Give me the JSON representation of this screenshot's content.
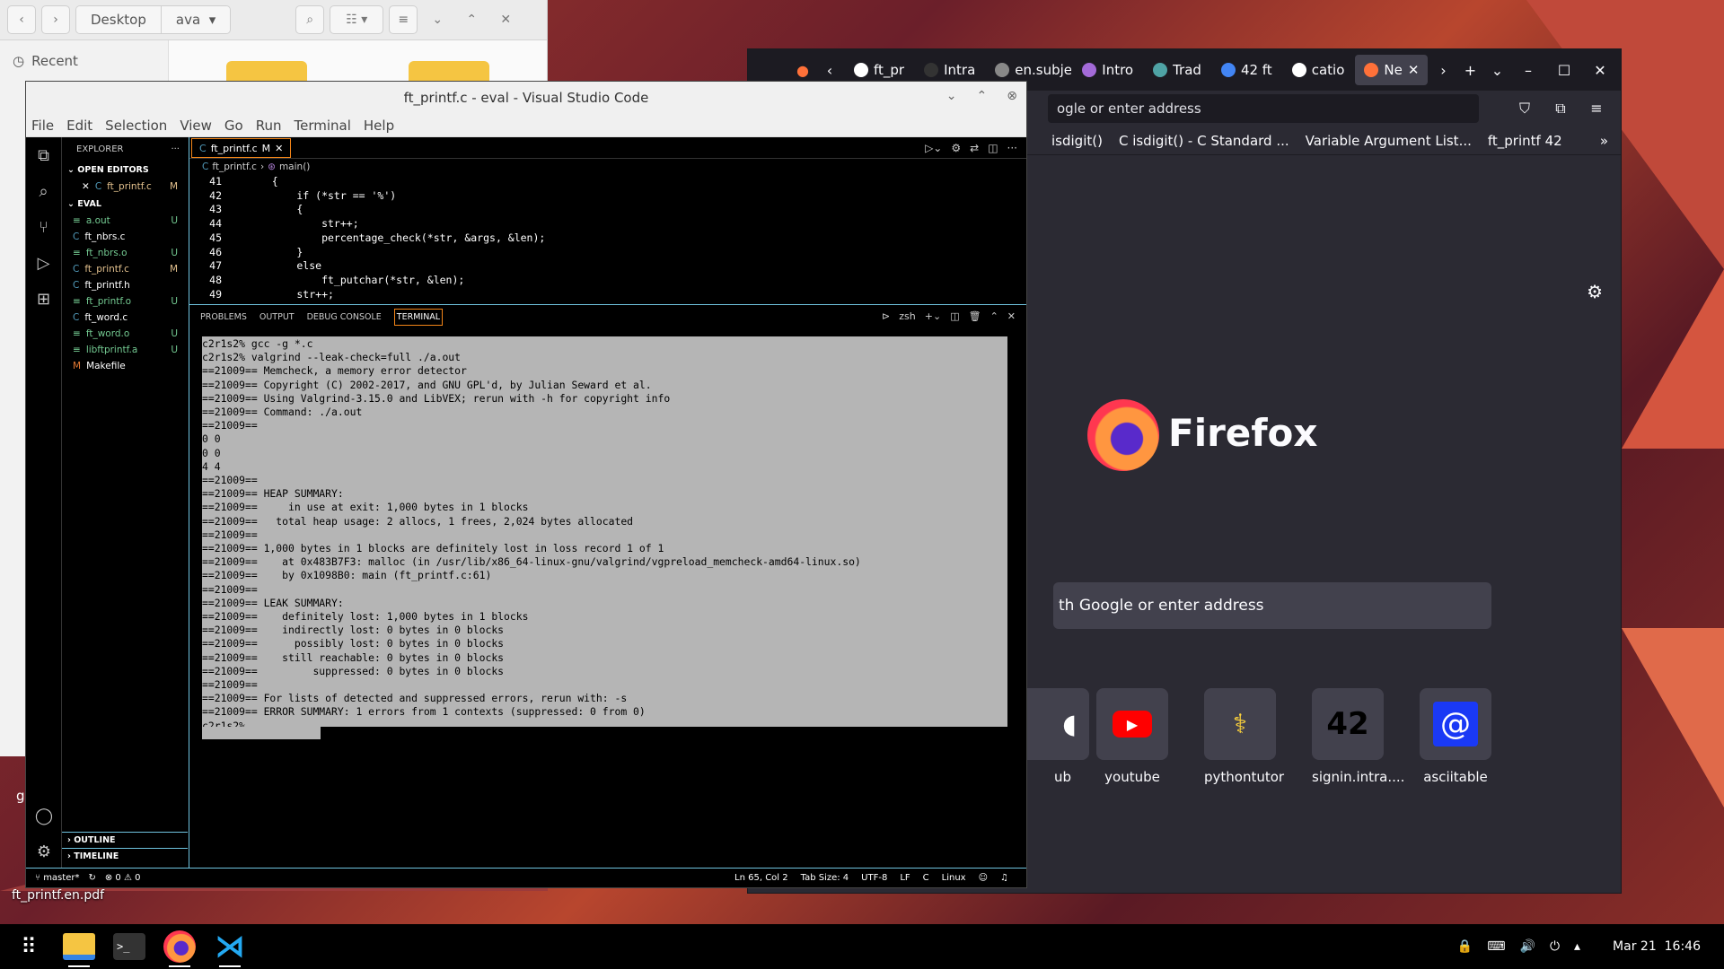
{
  "desktop": {
    "file_label": "ft_printf.en.pdf",
    "partial_label": "g"
  },
  "nautilus": {
    "path": [
      "Desktop",
      "ava"
    ],
    "sidebar_recent": "Recent"
  },
  "vscode": {
    "title": "ft_printf.c - eval - Visual Studio Code",
    "menu": [
      "File",
      "Edit",
      "Selection",
      "View",
      "Go",
      "Run",
      "Terminal",
      "Help"
    ],
    "explorer": {
      "header": "EXPLORER",
      "open_editors": "OPEN EDITORS",
      "open_file": "ft_printf.c",
      "open_file_badge": "M",
      "folder": "EVAL",
      "files": [
        {
          "name": "a.out",
          "badge": "U",
          "color": "#73c991",
          "icon": "≡"
        },
        {
          "name": "ft_nbrs.c",
          "badge": "",
          "color": "#ffffff",
          "icon": "C"
        },
        {
          "name": "ft_nbrs.o",
          "badge": "U",
          "color": "#73c991",
          "icon": "≡"
        },
        {
          "name": "ft_printf.c",
          "badge": "M",
          "color": "#e2c08d",
          "icon": "C"
        },
        {
          "name": "ft_printf.h",
          "badge": "",
          "color": "#ffffff",
          "icon": "C"
        },
        {
          "name": "ft_printf.o",
          "badge": "U",
          "color": "#73c991",
          "icon": "≡"
        },
        {
          "name": "ft_word.c",
          "badge": "",
          "color": "#ffffff",
          "icon": "C"
        },
        {
          "name": "ft_word.o",
          "badge": "U",
          "color": "#73c991",
          "icon": "≡"
        },
        {
          "name": "libftprintf.a",
          "badge": "U",
          "color": "#73c991",
          "icon": "≡"
        },
        {
          "name": "Makefile",
          "badge": "",
          "color": "#ffffff",
          "icon": "M"
        }
      ],
      "outline": "OUTLINE",
      "timeline": "TIMELINE"
    },
    "tab": {
      "label": "ft_printf.c",
      "badge": "M"
    },
    "breadcrumb": [
      "ft_printf.c",
      "main()"
    ],
    "code_lines": [
      {
        "n": "41",
        "text": "    {"
      },
      {
        "n": "42",
        "text": "        if (*str == '%')"
      },
      {
        "n": "43",
        "text": "        {"
      },
      {
        "n": "44",
        "text": "            str++;"
      },
      {
        "n": "45",
        "text": "            percentage_check(*str, &args, &len);"
      },
      {
        "n": "46",
        "text": "        }"
      },
      {
        "n": "47",
        "text": "        else"
      },
      {
        "n": "48",
        "text": "            ft_putchar(*str, &len);"
      },
      {
        "n": "49",
        "text": "        str++;"
      }
    ],
    "panel_tabs": [
      "PROBLEMS",
      "OUTPUT",
      "DEBUG CONSOLE",
      "TERMINAL"
    ],
    "shell": "zsh",
    "terminal_lines": [
      "c2r1s2% gcc -g *.c",
      "c2r1s2% valgrind --leak-check=full ./a.out",
      "==21009== Memcheck, a memory error detector",
      "==21009== Copyright (C) 2002-2017, and GNU GPL'd, by Julian Seward et al.",
      "==21009== Using Valgrind-3.15.0 and LibVEX; rerun with -h for copyright info",
      "==21009== Command: ./a.out",
      "==21009==",
      "0 0",
      "0 0",
      "4 4",
      "==21009==",
      "==21009== HEAP SUMMARY:",
      "==21009==     in use at exit: 1,000 bytes in 1 blocks",
      "==21009==   total heap usage: 2 allocs, 1 frees, 2,024 bytes allocated",
      "==21009==",
      "==21009== 1,000 bytes in 1 blocks are definitely lost in loss record 1 of 1",
      "==21009==    at 0x483B7F3: malloc (in /usr/lib/x86_64-linux-gnu/valgrind/vgpreload_memcheck-amd64-linux.so)",
      "==21009==    by 0x1098B0: main (ft_printf.c:61)",
      "==21009==",
      "==21009== LEAK SUMMARY:",
      "==21009==    definitely lost: 1,000 bytes in 1 blocks",
      "==21009==    indirectly lost: 0 bytes in 0 blocks",
      "==21009==      possibly lost: 0 bytes in 0 blocks",
      "==21009==    still reachable: 0 bytes in 0 blocks",
      "==21009==         suppressed: 0 bytes in 0 blocks",
      "==21009==",
      "==21009== For lists of detected and suppressed errors, rerun with: -s",
      "==21009== ERROR SUMMARY: 1 errors from 1 contexts (suppressed: 0 from 0)",
      "c2r1s2% "
    ],
    "status": {
      "branch": "master*",
      "problems": "⊗ 0 ⚠ 0",
      "position": "Ln 65, Col 2",
      "tab_size": "Tab Size: 4",
      "encoding": "UTF-8",
      "eol": "LF",
      "language": "C",
      "platform": "Linux"
    }
  },
  "firefox": {
    "tabs": [
      {
        "label": "ft_pr",
        "color": "#ffffff"
      },
      {
        "label": "Intra",
        "color": "#333333"
      },
      {
        "label": "en.subje",
        "color": "#888888"
      },
      {
        "label": "Intro",
        "color": "#a36ad8"
      },
      {
        "label": "Trad",
        "color": "#4fa3a5"
      },
      {
        "label": "42 ft",
        "color": "#4285f4"
      },
      {
        "label": "catio",
        "color": "#ffffff"
      },
      {
        "label": "Ne",
        "color": "#ff7139"
      }
    ],
    "url_placeholder": "ogle or enter address",
    "bookmarks": [
      "isdigit()",
      "C isdigit() - C Standard ...",
      "Variable Argument List...",
      "ft_printf 42"
    ],
    "brand": "Firefox",
    "search_placeholder": "th Google or enter address",
    "shortcuts": [
      {
        "label": "ub"
      },
      {
        "label": "youtube"
      },
      {
        "label": "pythontutor"
      },
      {
        "label": "signin.intra...."
      },
      {
        "label": "asciitable"
      }
    ]
  },
  "taskbar": {
    "date": "Mar 21",
    "time": "16:46"
  }
}
